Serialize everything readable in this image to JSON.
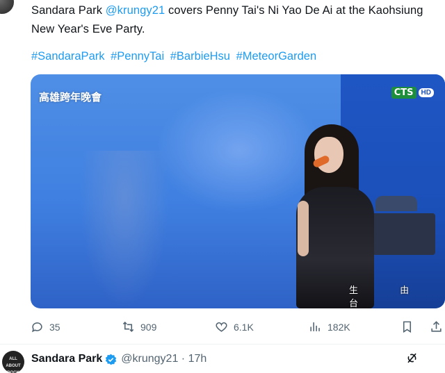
{
  "tweet": {
    "author": "Sandara Park",
    "mention": "@krungy21",
    "text_part1": " covers Penny Tai's Ni Yao De Ai at the Kaohsiung",
    "text_line2": "New Year's Eve Party.",
    "hashtags": [
      "#SandaraPark",
      "#PennyTai",
      "#BarbieHsu",
      "#MeteorGarden"
    ]
  },
  "media": {
    "broadcast_logo": "高雄跨年晚會",
    "channel_logo": "CTS",
    "channel_logo_hd": "HD",
    "subtitle_text": "生 由 台"
  },
  "actions": {
    "replies": "35",
    "retweets": "909",
    "likes": "6.1K",
    "views": "182K"
  },
  "next_tweet": {
    "avatar_text": "ALL ABOUT ROCK",
    "name": "Sandara Park",
    "handle_time": "@krungy21 · 17h"
  },
  "colors": {
    "accent": "#1d9bf0",
    "text": "#0f1419",
    "muted": "#536471"
  }
}
